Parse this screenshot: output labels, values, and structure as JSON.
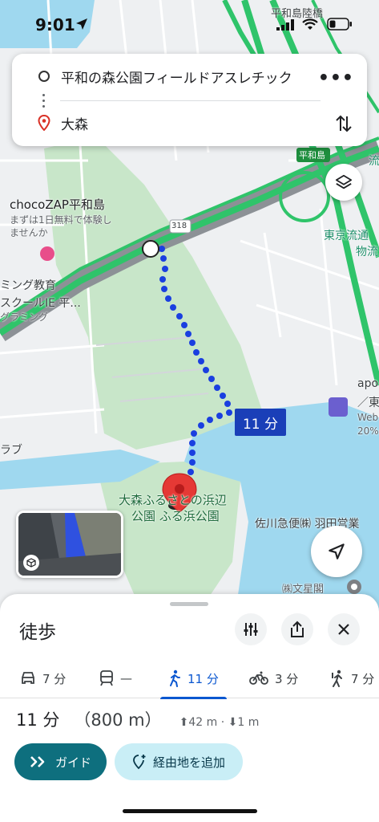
{
  "status_bar": {
    "time": "9:01"
  },
  "search": {
    "origin": "平和の森公園フィールドアスレチック",
    "destination": "大森"
  },
  "map": {
    "labels": {
      "choco": "chocoZAP平和島",
      "choco_sub1": "まずは1日無料で体験し",
      "choco_sub2": "ませんか",
      "school1": "ミング教育",
      "school2": "スクールIE 平...",
      "school3": "グラミング",
      "love": "ラブ",
      "heiwajima": "平和島",
      "heiwajima_riku": "平和島陸橋",
      "tokyo_ryutsu1": "東京流通",
      "tokyo_ryutsu2": "物流",
      "route_318": "318",
      "park1": "大森ふるさとの浜辺",
      "park2": "公園 ふる浜公園",
      "sagawa": "佐川急便㈱ 羽田営業",
      "bunseikaku": "㈱文星閣",
      "apo1": "apo",
      "apo2": "／東",
      "apo3": "Web",
      "apo4": "20%",
      "ryu": "流"
    },
    "duration_tag": "11 分"
  },
  "sheet": {
    "title": "徒歩",
    "modes": [
      {
        "icon": "car-icon",
        "label": "7 分"
      },
      {
        "icon": "transit-icon",
        "label": "—"
      },
      {
        "icon": "walk-icon",
        "label": "11 分"
      },
      {
        "icon": "bike-icon",
        "label": "3 分"
      },
      {
        "icon": "ride-icon",
        "label": "7 分"
      }
    ],
    "summary": {
      "time": "11 分",
      "distance": "（800 m）",
      "elevation": "⬆42 m · ⬇1 m"
    },
    "guide_label": "ガイド",
    "add_stop_label": "経由地を追加"
  },
  "colors": {
    "route": "#1a3fe0",
    "highway": "#2fc46a",
    "water": "#9fd8ef",
    "park": "#c8e6c9",
    "accent": "#0b57d0",
    "guide": "#0e6f7e"
  }
}
